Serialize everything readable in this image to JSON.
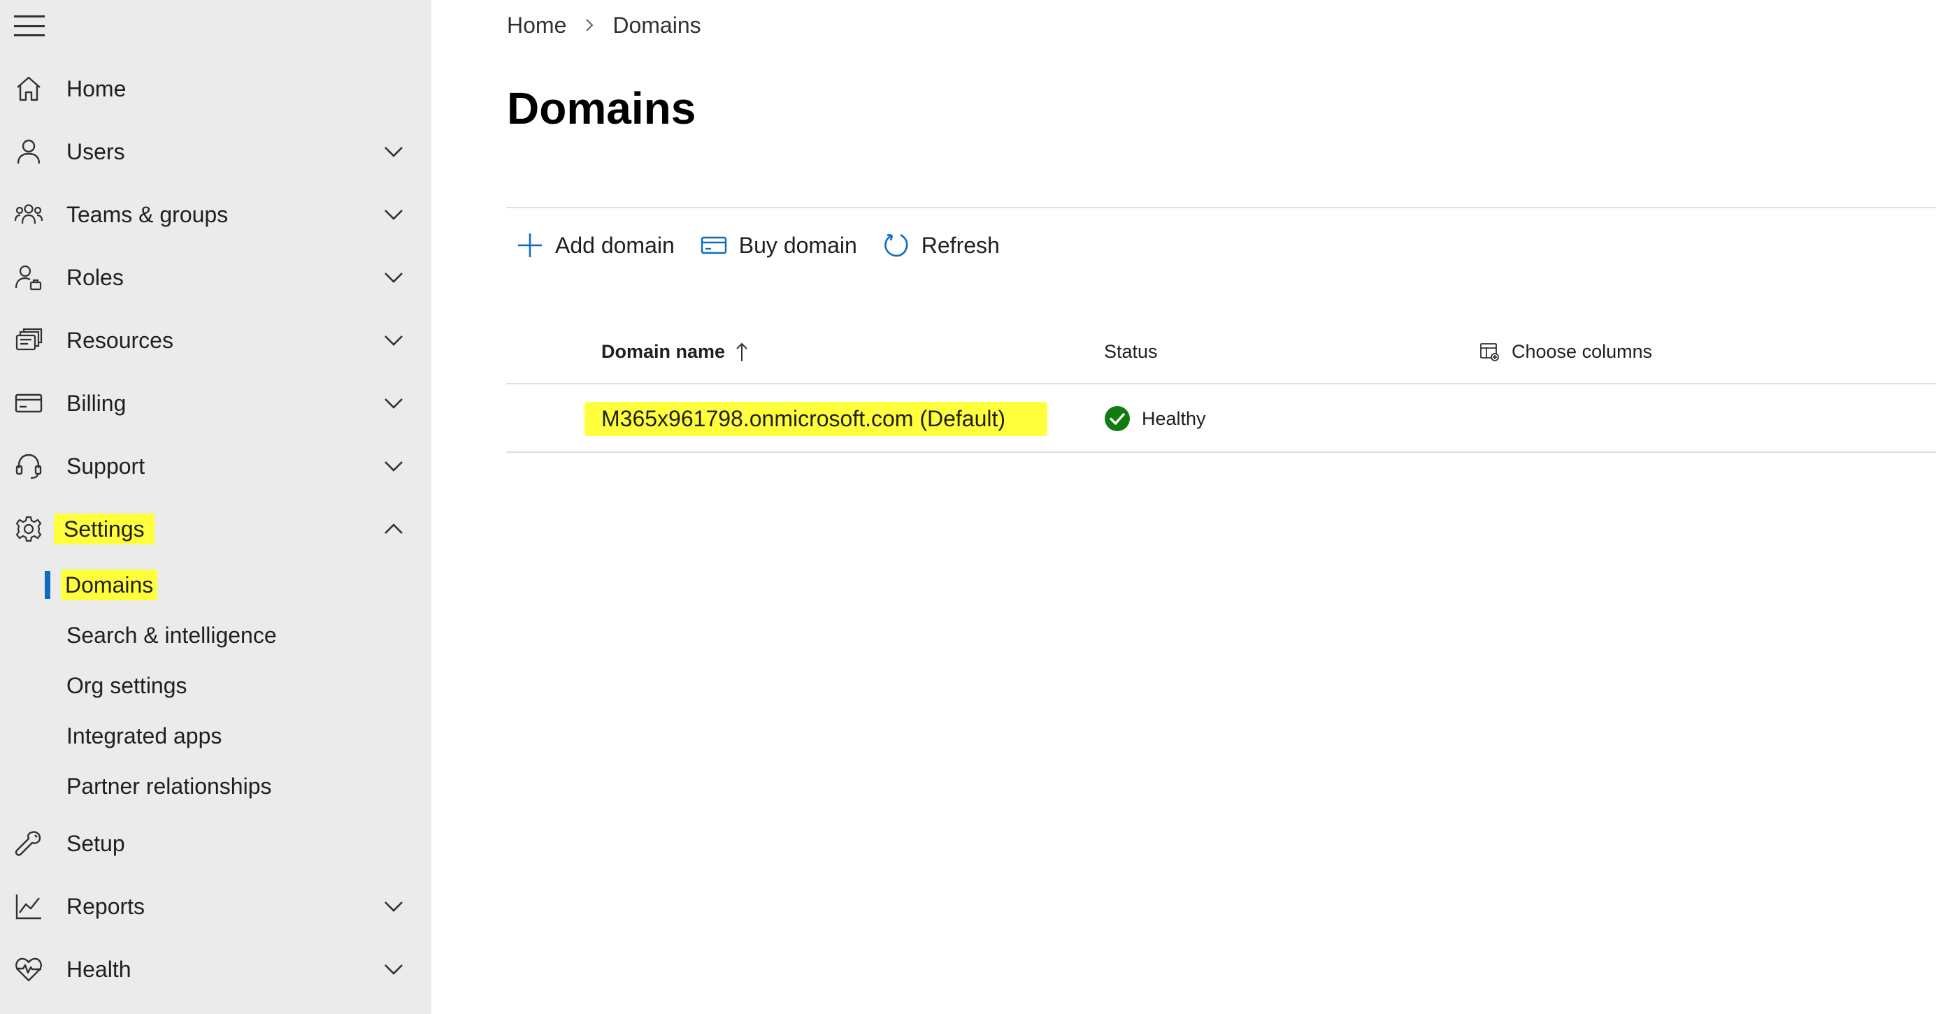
{
  "sidebar": {
    "items": [
      {
        "label": "Home",
        "icon": "home-icon"
      },
      {
        "label": "Users",
        "icon": "user-icon",
        "expand": "down"
      },
      {
        "label": "Teams & groups",
        "icon": "teams-icon",
        "expand": "down"
      },
      {
        "label": "Roles",
        "icon": "roles-icon",
        "expand": "down"
      },
      {
        "label": "Resources",
        "icon": "resources-icon",
        "expand": "down"
      },
      {
        "label": "Billing",
        "icon": "billing-icon",
        "expand": "down"
      },
      {
        "label": "Support",
        "icon": "headset-icon",
        "expand": "down"
      },
      {
        "label": "Settings",
        "icon": "gear-icon",
        "expand": "up"
      },
      {
        "label": "Setup",
        "icon": "wrench-icon"
      },
      {
        "label": "Reports",
        "icon": "chart-icon",
        "expand": "down"
      },
      {
        "label": "Health",
        "icon": "heart-pulse-icon",
        "expand": "down"
      }
    ],
    "settings_children": [
      {
        "label": "Domains",
        "active": true
      },
      {
        "label": "Search & intelligence"
      },
      {
        "label": "Org settings"
      },
      {
        "label": "Integrated apps"
      },
      {
        "label": "Partner relationships"
      }
    ]
  },
  "breadcrumb": {
    "home": "Home",
    "current": "Domains"
  },
  "page": {
    "title": "Domains"
  },
  "commands": {
    "add": "Add domain",
    "buy": "Buy domain",
    "refresh": "Refresh"
  },
  "table": {
    "headers": {
      "domain": "Domain name",
      "status": "Status",
      "choose_columns": "Choose columns"
    },
    "rows": [
      {
        "domain": "M365x961798.onmicrosoft.com (Default)",
        "status": "Healthy"
      }
    ]
  },
  "colors": {
    "sidebar_bg": "#ebebeb",
    "highlight": "#ffff3c",
    "active_indicator": "#0f6cbd",
    "healthy": "#107c10",
    "accent": "#0f6cbd"
  }
}
